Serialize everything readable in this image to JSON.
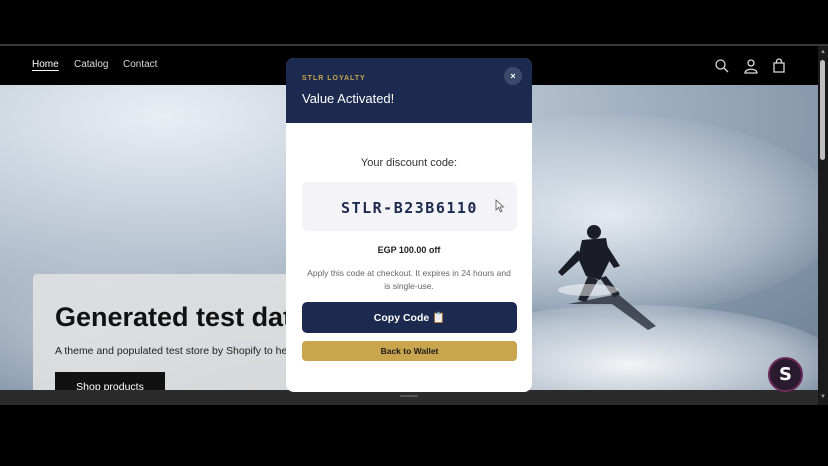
{
  "nav": {
    "items": [
      {
        "label": "Home"
      },
      {
        "label": "Catalog"
      },
      {
        "label": "Contact"
      }
    ],
    "icons": [
      "search-icon",
      "account-icon",
      "cart-icon"
    ]
  },
  "hero": {
    "title": "Generated test data",
    "subtitle": "A theme and populated test store by Shopify to help you test commerce",
    "button_label": "Shop products"
  },
  "modal": {
    "brand": "STLR LOYALTY",
    "title": "Value Activated!",
    "close_label": "×",
    "code_label": "Your discount code:",
    "code": "STLR-B23B6110",
    "amount": "EGP 100.00 off",
    "note": "Apply this code at checkout. It expires in 24 hours and is single-use.",
    "copy_label": "Copy Code 📋",
    "back_label": "Back to Wallet"
  },
  "floating_widget": {
    "icon": "stlr-logo-icon",
    "letter": "S"
  },
  "colors": {
    "modal_header": "#1b2a4e",
    "gold": "#c9a64e",
    "code_bg": "#f3f3f8"
  }
}
